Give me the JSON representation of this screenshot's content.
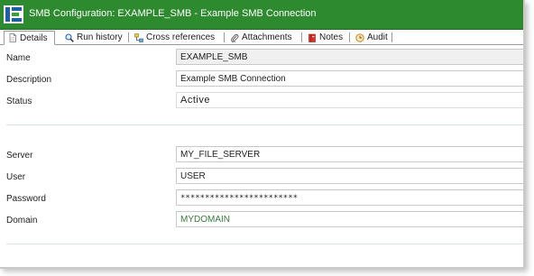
{
  "window": {
    "title": "SMB Configuration: EXAMPLE_SMB - Example SMB Connection",
    "accent_color": "#2e8a2e"
  },
  "tabs": [
    {
      "label": "Details",
      "icon": "document-icon",
      "active": true
    },
    {
      "label": "Run history",
      "icon": "search-icon",
      "active": false
    },
    {
      "label": "Cross references",
      "icon": "cross-references-icon",
      "active": false
    },
    {
      "label": "Attachments",
      "icon": "paperclip-icon",
      "active": false
    },
    {
      "label": "Notes",
      "icon": "notes-book-icon",
      "active": false
    },
    {
      "label": "Audit",
      "icon": "audit-clock-icon",
      "active": false
    }
  ],
  "form": {
    "name": {
      "label": "Name",
      "value": "EXAMPLE_SMB"
    },
    "description": {
      "label": "Description",
      "value": "Example SMB Connection"
    },
    "status": {
      "label": "Status",
      "value": "Active"
    },
    "server": {
      "label": "Server",
      "value": "MY_FILE_SERVER"
    },
    "user": {
      "label": "User",
      "value": "USER"
    },
    "password": {
      "label": "Password",
      "value": "************************"
    },
    "domain": {
      "label": "Domain",
      "value": "MYDOMAIN",
      "value_color": "#3a7a3a"
    }
  }
}
